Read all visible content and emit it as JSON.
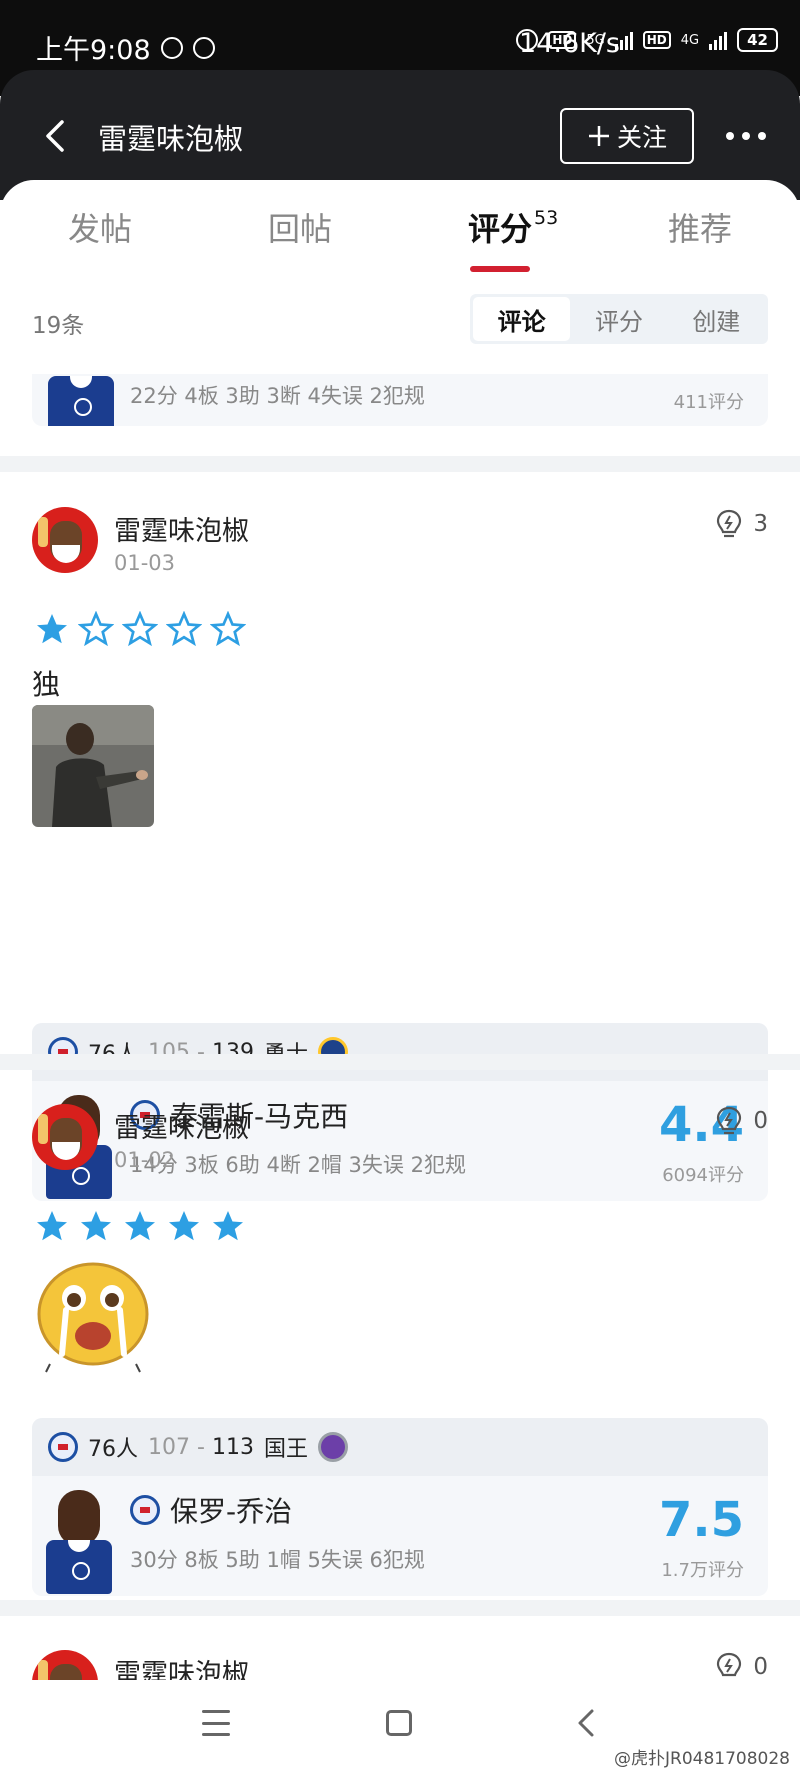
{
  "status_bar": {
    "time": "上午9:08",
    "speed": "14.6K/s",
    "net1": "5G",
    "net2": "4G",
    "hd": "HD",
    "battery": "42"
  },
  "header": {
    "title": "雷霆味泡椒",
    "follow_label": "关注"
  },
  "tabs": [
    {
      "label": "发帖"
    },
    {
      "label": "回帖"
    },
    {
      "label": "评分",
      "count": "53"
    },
    {
      "label": "推荐"
    }
  ],
  "list": {
    "count_label": "19条",
    "segments": [
      "评论",
      "评分",
      "创建"
    ]
  },
  "partial_card": {
    "stats": "22分 4板 3助 3断 4失误 2犯规",
    "votes": "411评分"
  },
  "posts": [
    {
      "author": "雷霆味泡椒",
      "date": "01-03",
      "likes": "3",
      "rating": 1,
      "text": "独",
      "game": {
        "home": "76人",
        "home_score": "105",
        "sep": "-",
        "away_score": "139",
        "away": "勇士"
      },
      "player": {
        "name": "泰雷斯-马克西",
        "stats": "14分 3板 6助 4断 2帽 3失误 2犯规",
        "score": "4.4",
        "votes": "6094评分"
      }
    },
    {
      "author": "雷霆味泡椒",
      "date": "01-02",
      "likes": "0",
      "rating": 5,
      "text": "",
      "game": {
        "home": "76人",
        "home_score": "107",
        "sep": "-",
        "away_score": "113",
        "away": "国王"
      },
      "player": {
        "name": "保罗-乔治",
        "stats": "30分 8板 5助 1帽 5失误 6犯规",
        "score": "7.5",
        "votes": "1.7万评分"
      }
    },
    {
      "author": "雷霆味泡椒",
      "likes": "0"
    }
  ],
  "watermark": "@虎扑JR0481708028",
  "colors": {
    "accent_red": "#d22030",
    "score_blue": "#2f9fe0",
    "star_blue": "#2d9fe3",
    "header_bg": "#1f2023"
  }
}
